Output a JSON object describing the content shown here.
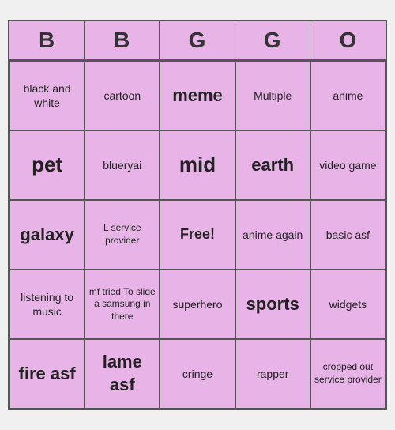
{
  "header": {
    "letters": [
      "B",
      "B",
      "G",
      "G",
      "O"
    ]
  },
  "cells": [
    {
      "text": "black and white",
      "size": "normal"
    },
    {
      "text": "cartoon",
      "size": "normal"
    },
    {
      "text": "meme",
      "size": "large"
    },
    {
      "text": "Multiple",
      "size": "normal"
    },
    {
      "text": "anime",
      "size": "normal"
    },
    {
      "text": "pet",
      "size": "xlarge"
    },
    {
      "text": "blueryai",
      "size": "normal"
    },
    {
      "text": "mid",
      "size": "xlarge"
    },
    {
      "text": "earth",
      "size": "large"
    },
    {
      "text": "video game",
      "size": "normal"
    },
    {
      "text": "galaxy",
      "size": "large"
    },
    {
      "text": "L service provider",
      "size": "small"
    },
    {
      "text": "Free!",
      "size": "free"
    },
    {
      "text": "anime again",
      "size": "normal"
    },
    {
      "text": "basic asf",
      "size": "normal"
    },
    {
      "text": "listening to music",
      "size": "normal"
    },
    {
      "text": "mf tried To slide a samsung in there",
      "size": "small"
    },
    {
      "text": "superhero",
      "size": "normal"
    },
    {
      "text": "sports",
      "size": "large"
    },
    {
      "text": "widgets",
      "size": "normal"
    },
    {
      "text": "fire asf",
      "size": "large"
    },
    {
      "text": "lame asf",
      "size": "large"
    },
    {
      "text": "cringe",
      "size": "normal"
    },
    {
      "text": "rapper",
      "size": "normal"
    },
    {
      "text": "cropped out service provider",
      "size": "small"
    }
  ]
}
